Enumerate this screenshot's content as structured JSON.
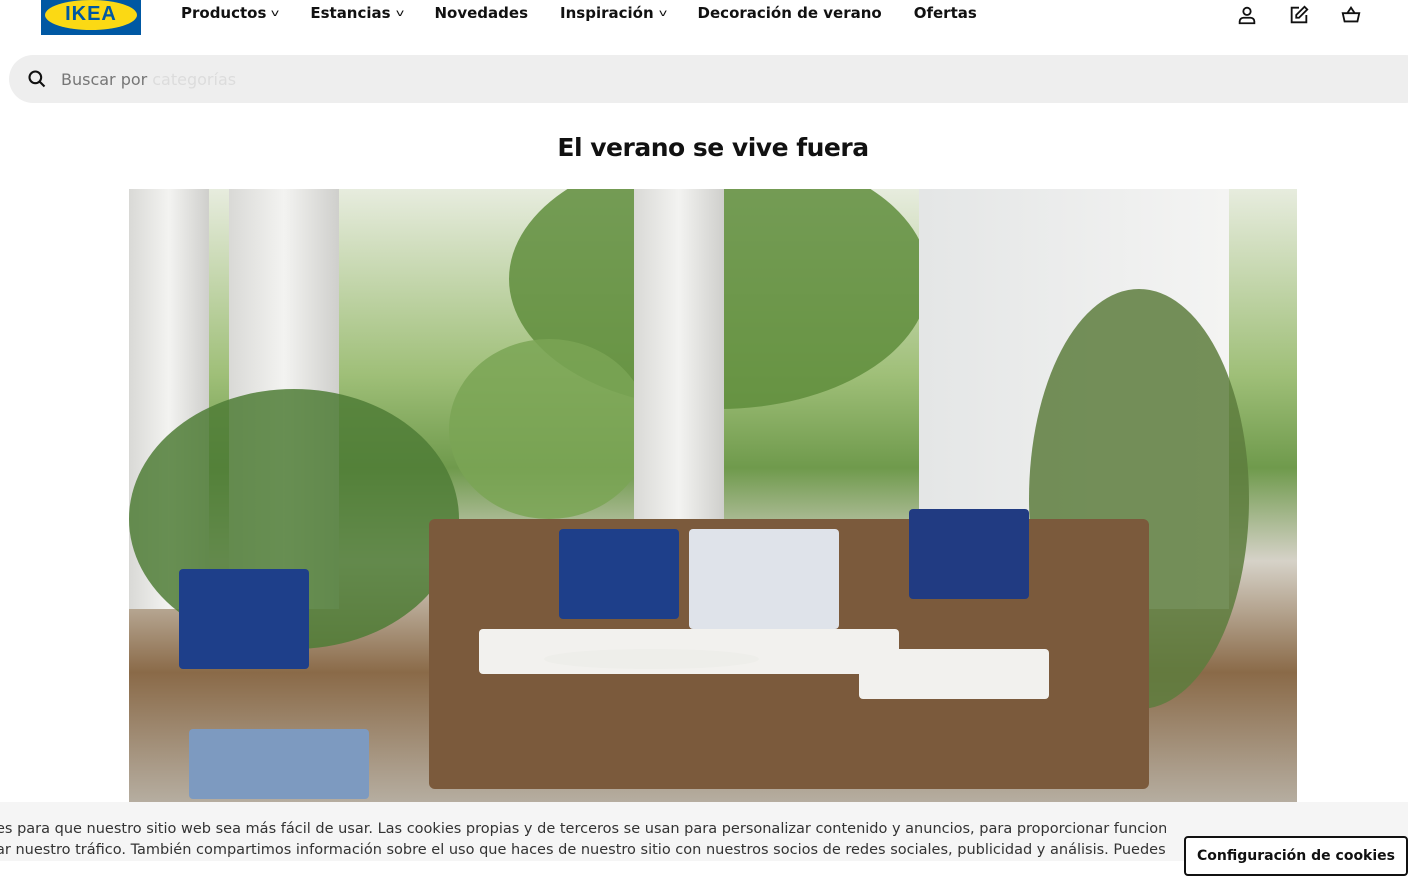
{
  "header": {
    "logo": "IKEA",
    "nav": [
      {
        "label": "Productos",
        "dropdown": true
      },
      {
        "label": "Estancias",
        "dropdown": true
      },
      {
        "label": "Novedades",
        "dropdown": false
      },
      {
        "label": "Inspiración",
        "dropdown": true
      },
      {
        "label": "Decoración de verano",
        "dropdown": false
      },
      {
        "label": "Ofertas",
        "dropdown": false
      }
    ],
    "icons": [
      "user-icon",
      "shopping-list-icon",
      "cart-icon"
    ]
  },
  "search": {
    "placeholder": "Buscar por",
    "placeholder_faded": "categorías"
  },
  "main": {
    "title": "El verano se vive fuera"
  },
  "cookie": {
    "line1": "es para que nuestro sitio web sea más fácil de usar. Las cookies propias y de terceros se usan para personalizar contenido y anuncios, para proporcionar funciones de",
    "line2": "ar nuestro tráfico. También compartimos información sobre el uso que haces de nuestro sitio con nuestros socios de redes sociales, publicidad y análisis. Puedes",
    "settings_button": "Configuración de cookies"
  }
}
